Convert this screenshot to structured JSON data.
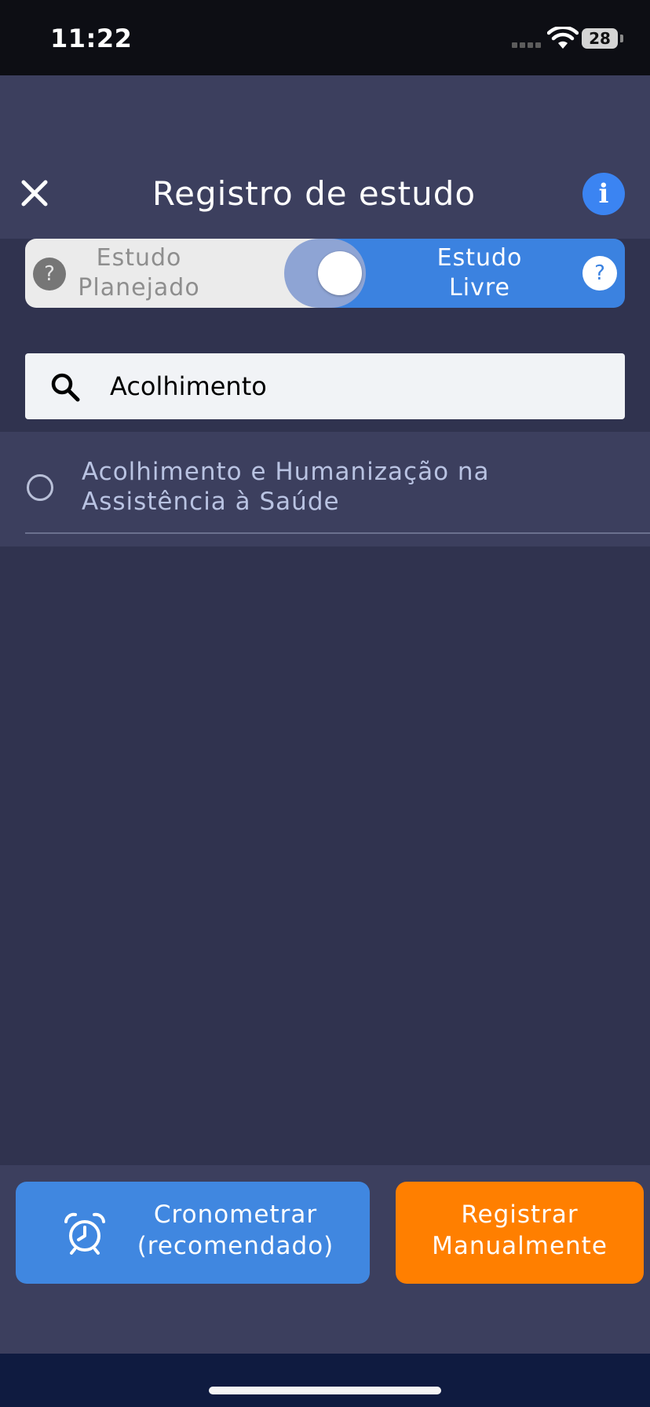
{
  "status_bar": {
    "time": "11:22",
    "battery": "28"
  },
  "header": {
    "title": "Registro de estudo",
    "info_label": "i"
  },
  "mode_toggle": {
    "left_label": "Estudo\nPlanejado",
    "right_label": "Estudo\nLivre",
    "help_label": "?",
    "selected": "Estudo Livre"
  },
  "search": {
    "value": "Acolhimento",
    "placeholder": ""
  },
  "results": [
    {
      "label": "Acolhimento e Humanização na Assistência à Saúde",
      "selected": false
    }
  ],
  "actions": {
    "timer_label": "Cronometrar\n(recomendado)",
    "manual_label": "Registrar\nManualmente"
  },
  "colors": {
    "accent_blue": "#3b82e0",
    "accent_orange": "#ff7f00",
    "header_bg": "#3c3f5e",
    "page_bg": "#30334f"
  }
}
